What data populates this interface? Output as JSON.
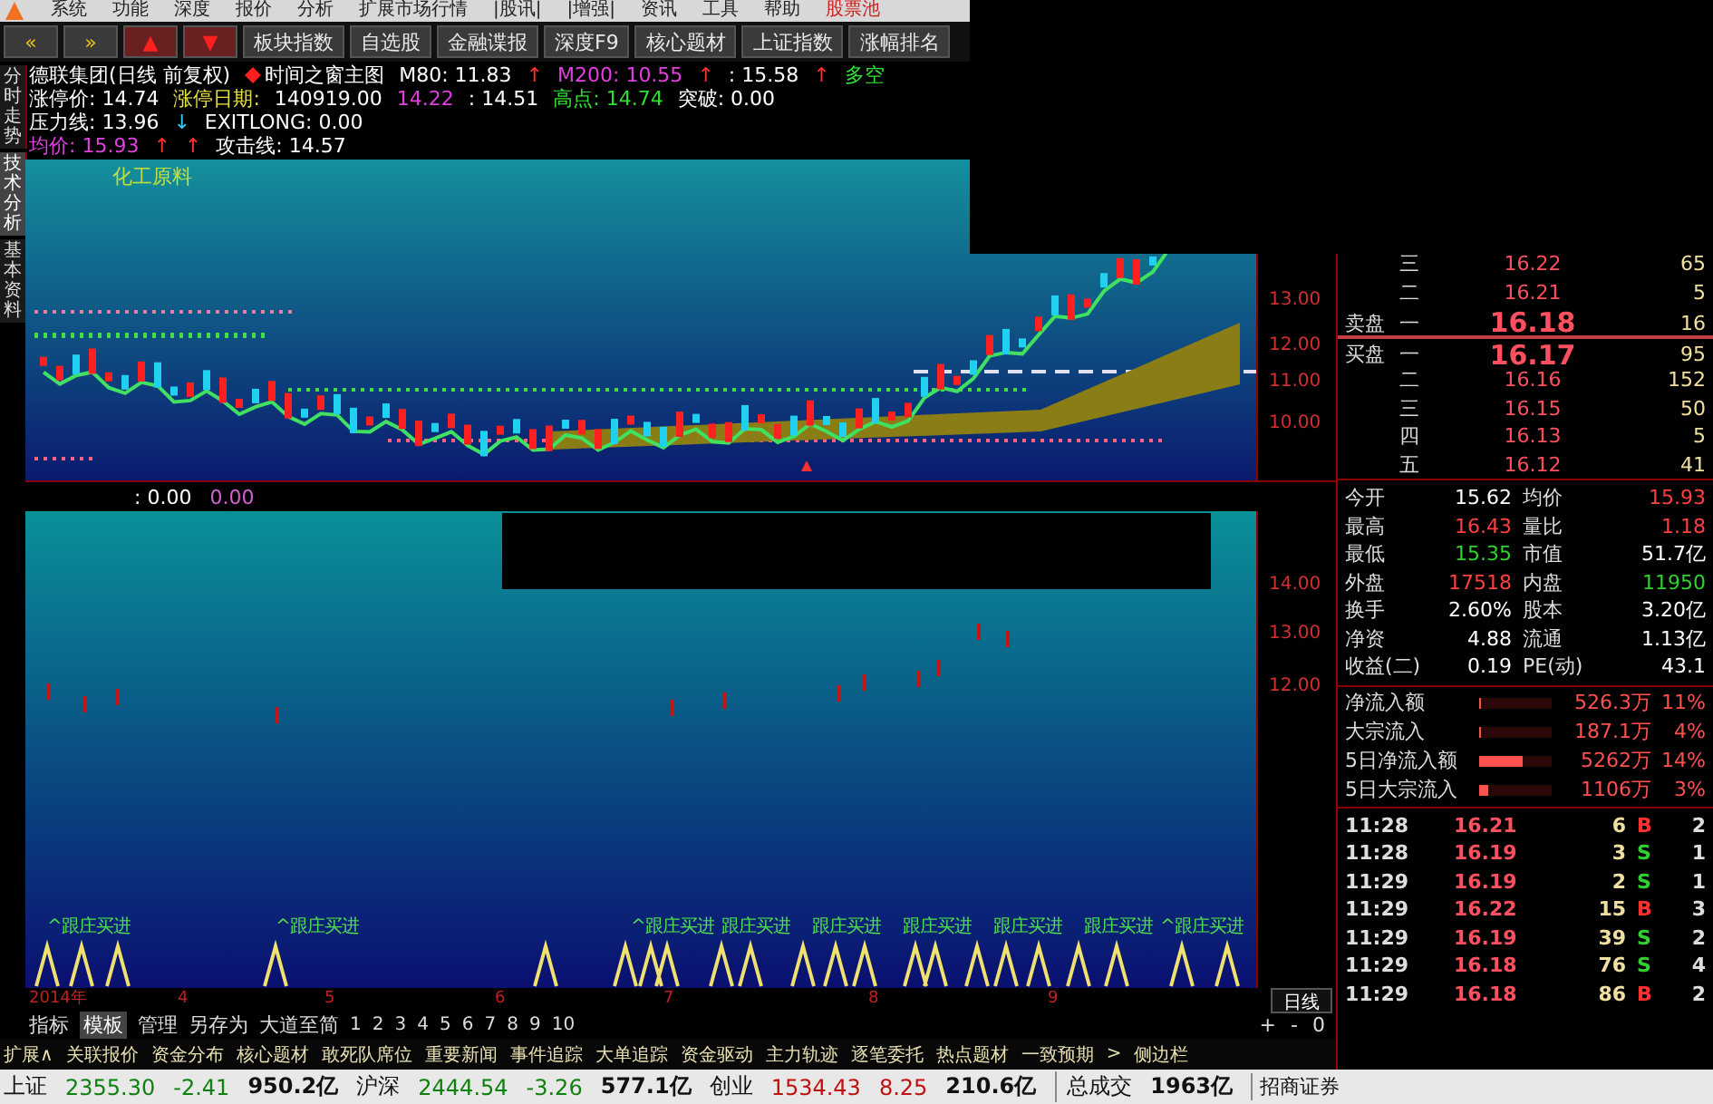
{
  "menu": {
    "items": [
      "系统",
      "功能",
      "深度",
      "报价",
      "分析",
      "扩展市场行情",
      "|股讯|",
      "|增强|",
      "资讯",
      "工具",
      "帮助"
    ],
    "highlight": "股票池"
  },
  "toolbar": [
    {
      "label": "«",
      "kind": "nav"
    },
    {
      "label": "»",
      "kind": "nav"
    },
    {
      "label": "▲",
      "kind": "arrow"
    },
    {
      "label": "▼",
      "kind": "arrow"
    },
    {
      "label": "板块指数",
      "kind": "text"
    },
    {
      "label": "自选股",
      "kind": "text"
    },
    {
      "label": "金融谍报",
      "kind": "text"
    },
    {
      "label": "深度F9",
      "kind": "text"
    },
    {
      "label": "核心题材",
      "kind": "text"
    },
    {
      "label": "上证指数",
      "kind": "text"
    },
    {
      "label": "涨幅排名",
      "kind": "text"
    }
  ],
  "side_tabs": [
    {
      "label": "分时走势",
      "selected": false
    },
    {
      "label": "技术分析",
      "selected": true
    },
    {
      "label": "基本资料",
      "selected": false
    }
  ],
  "header": [
    {
      "segments": [
        {
          "text": "德联集团(日线 前复权)",
          "color": "#ffffff"
        },
        {
          "text": "时间之窗主图",
          "color": "#ffffff",
          "icon": true
        },
        {
          "text": "M80: 11.83",
          "color": "#ffffff"
        },
        {
          "text": "↑",
          "color": "#ff3030"
        },
        {
          "text": "M200: 10.55",
          "color": "#e040e0"
        },
        {
          "text": "↑",
          "color": "#ff3030"
        },
        {
          "text": ": 15.58",
          "color": "#ffffff"
        },
        {
          "text": "↑",
          "color": "#ff3030"
        },
        {
          "text": "多空",
          "color": "#30e030"
        }
      ]
    },
    {
      "segments": [
        {
          "text": "涨停价: 14.74",
          "color": "#ffffff"
        },
        {
          "text": "涨停日期:",
          "color": "#e8e040"
        },
        {
          "text": "140919.00",
          "color": "#ffffff"
        },
        {
          "text": "14.22",
          "color": "#e040e0"
        },
        {
          "text": ": 14.51",
          "color": "#ffffff"
        },
        {
          "text": "高点: 14.74",
          "color": "#30e030"
        },
        {
          "text": "突破: 0.00",
          "color": "#ffffff"
        }
      ]
    },
    {
      "segments": [
        {
          "text": "压力线: 13.96",
          "color": "#ffffff"
        },
        {
          "text": "↓",
          "color": "#30d0f0"
        },
        {
          "text": "EXITLONG: 0.00",
          "color": "#ffffff"
        }
      ]
    },
    {
      "segments": [
        {
          "text": "均价: 15.93",
          "color": "#e040e0"
        },
        {
          "text": "↑",
          "color": "#ff3030"
        },
        {
          "text": "↑",
          "color": "#ff3030"
        },
        {
          "text": "攻击线: 14.57",
          "color": "#ffffff"
        }
      ]
    }
  ],
  "chart": {
    "annotation": "化工原料",
    "yaxis": [
      "13.00",
      "12.00",
      "11.00",
      "10.00"
    ]
  },
  "indicator": {
    "values": [
      {
        "text": ": 0.00",
        "color": "#ffffff"
      },
      {
        "text": "0.00",
        "color": "#d060d0"
      }
    ],
    "yaxis": [
      "14.00",
      "13.00",
      "12.00"
    ],
    "signals": [
      "^跟庄买进",
      "^跟庄买进",
      "^跟庄买进",
      "跟庄买进",
      "跟庄买进",
      "跟庄买进",
      "跟庄买进",
      "跟庄买进",
      "^跟庄买进"
    ]
  },
  "dates": [
    "2014年",
    "4",
    "5",
    "6",
    "7",
    "8",
    "9"
  ],
  "period": {
    "label": "日线",
    "controls": [
      "+",
      "-",
      "0"
    ]
  },
  "indicator_tabs": [
    {
      "label": "指标",
      "selected": false
    },
    {
      "label": "模板",
      "selected": true
    },
    {
      "label": "管理",
      "selected": false
    },
    {
      "label": "另存为",
      "selected": false
    },
    {
      "label": "大道至简",
      "selected": false
    }
  ],
  "pages": [
    "1",
    "2",
    "3",
    "4",
    "5",
    "6",
    "7",
    "8",
    "9",
    "10"
  ],
  "footer_tabs": [
    "扩展∧",
    "关联报价",
    "资金分布",
    "核心题材",
    "敢死队席位",
    "重要新闻",
    "事件追踪",
    "大单追踪",
    "资金驱动",
    "主力轨迹",
    "逐笔委托",
    "热点题材",
    "一致预期",
    ">",
    "侧边栏"
  ],
  "status": [
    {
      "label": "上证",
      "value": "2355.30",
      "change": "-2.41",
      "amount": "950.2亿",
      "color": "#108010"
    },
    {
      "label": "沪深",
      "value": "2444.54",
      "change": "-3.26",
      "amount": "577.1亿",
      "color": "#108010"
    },
    {
      "label": "创业",
      "value": "1534.43",
      "change": "8.25",
      "amount": "210.6亿",
      "color": "#c01010"
    }
  ],
  "turnover": {
    "label": "总成交",
    "value": "1963亿"
  },
  "broker": "招商证券",
  "order_book": [
    {
      "level": "三",
      "price": "16.22",
      "volume": "65",
      "kind": "normal"
    },
    {
      "level": "二",
      "price": "16.21",
      "volume": "5",
      "kind": "normal"
    },
    {
      "side": "卖盘",
      "level": "一",
      "price": "16.18",
      "volume": "16",
      "kind": "best"
    },
    {
      "side": "买盘",
      "level": "一",
      "price": "16.17",
      "volume": "95",
      "kind": "best"
    },
    {
      "level": "二",
      "price": "16.16",
      "volume": "152",
      "kind": "normal"
    },
    {
      "level": "三",
      "price": "16.15",
      "volume": "50",
      "kind": "normal"
    },
    {
      "level": "四",
      "price": "16.13",
      "volume": "5",
      "kind": "normal"
    },
    {
      "level": "五",
      "price": "16.12",
      "volume": "41",
      "kind": "normal"
    }
  ],
  "stats": [
    {
      "label": "今开",
      "value": "15.62",
      "color": "#ffffff"
    },
    {
      "label": "均价",
      "value": "15.93",
      "color": "#ff4040"
    },
    {
      "label": "最高",
      "value": "16.43",
      "color": "#ff4040"
    },
    {
      "label": "量比",
      "value": "1.18",
      "color": "#ff4040"
    },
    {
      "label": "最低",
      "value": "15.35",
      "color": "#30d030"
    },
    {
      "label": "市值",
      "value": "51.7亿",
      "color": "#ffffff"
    },
    {
      "label": "外盘",
      "value": "17518",
      "color": "#ff4040"
    },
    {
      "label": "内盘",
      "value": "11950",
      "color": "#30d030"
    },
    {
      "label": "换手",
      "value": "2.60%",
      "color": "#ffffff"
    },
    {
      "label": "股本",
      "value": "3.20亿",
      "color": "#ffffff"
    },
    {
      "label": "净资",
      "value": "4.88",
      "color": "#ffffff"
    },
    {
      "label": "流通",
      "value": "1.13亿",
      "color": "#ffffff"
    },
    {
      "label": "收益(二)",
      "value": "0.19",
      "color": "#ffffff"
    },
    {
      "label": "PE(动)",
      "value": "43.1",
      "color": "#ffffff"
    }
  ],
  "flows": [
    {
      "label": "净流入额",
      "level": 0.03,
      "amount": "526.3万",
      "percent": "11%"
    },
    {
      "label": "大宗流入",
      "level": 0.03,
      "amount": "187.1万",
      "percent": "4%"
    },
    {
      "label": "5日净流入额",
      "level": 0.6,
      "amount": "5262万",
      "percent": "14%"
    },
    {
      "label": "5日大宗流入",
      "level": 0.12,
      "amount": "1106万",
      "percent": "3%"
    }
  ],
  "ticks": [
    {
      "time": "11:28",
      "price": "16.21",
      "volume": "6",
      "side": "B",
      "kind": "buy",
      "count": "2"
    },
    {
      "time": "11:28",
      "price": "16.19",
      "volume": "3",
      "side": "S",
      "kind": "sell",
      "count": "1"
    },
    {
      "time": "11:29",
      "price": "16.19",
      "volume": "2",
      "side": "S",
      "kind": "sell",
      "count": "1"
    },
    {
      "time": "11:29",
      "price": "16.22",
      "volume": "15",
      "side": "B",
      "kind": "buy",
      "count": "3"
    },
    {
      "time": "11:29",
      "price": "16.19",
      "volume": "39",
      "side": "S",
      "kind": "sell",
      "count": "2"
    },
    {
      "time": "11:29",
      "price": "16.18",
      "volume": "76",
      "side": "S",
      "kind": "sell",
      "count": "4"
    },
    {
      "time": "11:29",
      "price": "16.18",
      "volume": "86",
      "side": "B",
      "kind": "buy",
      "count": "2"
    }
  ]
}
